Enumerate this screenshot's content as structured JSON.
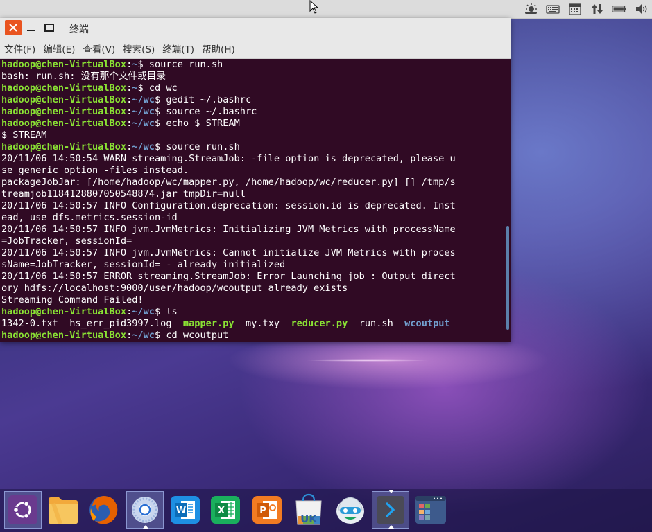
{
  "window": {
    "title": "终端"
  },
  "menubar": [
    {
      "label": "文件(F)"
    },
    {
      "label": "编辑(E)"
    },
    {
      "label": "查看(V)"
    },
    {
      "label": "搜索(S)"
    },
    {
      "label": "终端(T)"
    },
    {
      "label": "帮助(H)"
    }
  ],
  "terminal": {
    "user": "hadoop@chen-VirtualBox",
    "lines": [
      {
        "kind": "prompt",
        "path": "~",
        "cmd": " source run.sh"
      },
      {
        "kind": "out",
        "text": "bash: run.sh: 没有那个文件或目录"
      },
      {
        "kind": "prompt",
        "path": "~",
        "cmd": " cd wc"
      },
      {
        "kind": "prompt",
        "path": "~/wc",
        "cmd": " gedit ~/.bashrc"
      },
      {
        "kind": "prompt",
        "path": "~/wc",
        "cmd": " source ~/.bashrc"
      },
      {
        "kind": "prompt",
        "path": "~/wc",
        "cmd": " echo $ STREAM"
      },
      {
        "kind": "out",
        "text": "$ STREAM"
      },
      {
        "kind": "prompt",
        "path": "~/wc",
        "cmd": " source run.sh"
      },
      {
        "kind": "out",
        "text": "20/11/06 14:50:54 WARN streaming.StreamJob: -file option is deprecated, please u"
      },
      {
        "kind": "out",
        "text": "se generic option -files instead."
      },
      {
        "kind": "out",
        "text": "packageJobJar: [/home/hadoop/wc/mapper.py, /home/hadoop/wc/reducer.py] [] /tmp/s"
      },
      {
        "kind": "out",
        "text": "treamjob1184128807050548874.jar tmpDir=null"
      },
      {
        "kind": "out",
        "text": "20/11/06 14:50:57 INFO Configuration.deprecation: session.id is deprecated. Inst"
      },
      {
        "kind": "out",
        "text": "ead, use dfs.metrics.session-id"
      },
      {
        "kind": "out",
        "text": "20/11/06 14:50:57 INFO jvm.JvmMetrics: Initializing JVM Metrics with processName"
      },
      {
        "kind": "out",
        "text": "=JobTracker, sessionId="
      },
      {
        "kind": "out",
        "text": "20/11/06 14:50:57 INFO jvm.JvmMetrics: Cannot initialize JVM Metrics with proces"
      },
      {
        "kind": "out",
        "text": "sName=JobTracker, sessionId= - already initialized"
      },
      {
        "kind": "out",
        "text": "20/11/06 14:50:57 ERROR streaming.StreamJob: Error Launching job : Output direct"
      },
      {
        "kind": "out",
        "text": "ory hdfs://localhost:9000/user/hadoop/wcoutput already exists"
      },
      {
        "kind": "out",
        "text": "Streaming Command Failed!"
      },
      {
        "kind": "prompt",
        "path": "~/wc",
        "cmd": " ls"
      },
      {
        "kind": "ls",
        "items": [
          {
            "name": "1342-0.txt",
            "style": "t",
            "pad": "  "
          },
          {
            "name": "hs_err_pid3997.log",
            "style": "t",
            "pad": "  "
          },
          {
            "name": "mapper.py",
            "style": "g",
            "pad": "  "
          },
          {
            "name": "my.txy",
            "style": "t",
            "pad": "  "
          },
          {
            "name": "reducer.py",
            "style": "g",
            "pad": "  "
          },
          {
            "name": "run.sh",
            "style": "t",
            "pad": "  "
          },
          {
            "name": "wcoutput",
            "style": "b",
            "pad": ""
          }
        ]
      },
      {
        "kind": "prompt",
        "path": "~/wc",
        "cmd": " cd wcoutput"
      }
    ]
  },
  "tray": [
    {
      "icon": "weather-sun-icon"
    },
    {
      "icon": "keyboard-icon"
    },
    {
      "icon": "calendar-icon"
    },
    {
      "icon": "network-transfer-icon"
    },
    {
      "icon": "battery-icon"
    },
    {
      "icon": "volume-icon"
    }
  ],
  "dock": [
    {
      "icon": "ubuntu-logo-icon"
    },
    {
      "icon": "files-folder-icon"
    },
    {
      "icon": "firefox-icon"
    },
    {
      "icon": "chromium-browser-icon"
    },
    {
      "icon": "wps-writer-icon"
    },
    {
      "icon": "wps-spreadsheets-icon"
    },
    {
      "icon": "wps-presentation-icon"
    },
    {
      "icon": "ubuntu-kylin-software-center-icon",
      "label": "UK"
    },
    {
      "icon": "youker-assistant-icon"
    },
    {
      "icon": "terminal-icon"
    },
    {
      "icon": "workspace-switcher-icon"
    }
  ],
  "colors": {
    "terminal_bg": "#300a24",
    "prompt_user": "#8ae234",
    "prompt_path": "#729fcf",
    "close_button": "#e95420"
  }
}
